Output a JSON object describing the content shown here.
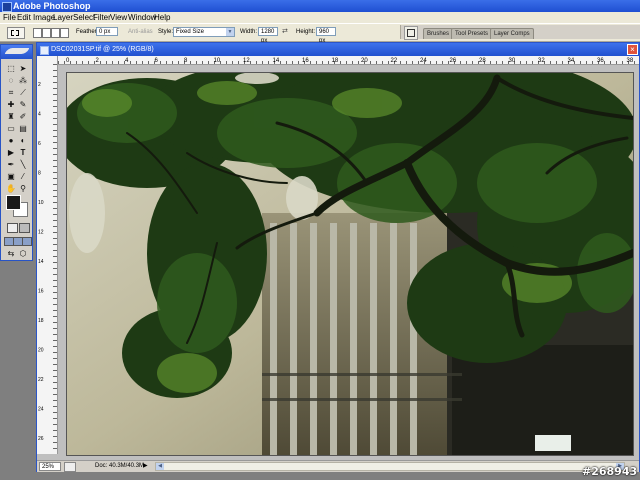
{
  "app": {
    "title": "Adobe Photoshop"
  },
  "menu": [
    "File",
    "Edit",
    "Image",
    "Layer",
    "Select",
    "Filter",
    "View",
    "Window",
    "Help"
  ],
  "options": {
    "feather_label": "Feather:",
    "feather_value": "0 px",
    "antialias_label": "Anti-alias",
    "style_label": "Style:",
    "style_value": "Fixed Size",
    "width_label": "Width:",
    "width_value": "1280 px",
    "height_label": "Height:",
    "height_value": "960 px"
  },
  "palette_well": {
    "tabs": [
      "Brushes",
      "Tool Presets",
      "Layer Comps"
    ]
  },
  "document": {
    "title": "DSC02031SP.tif @ 25% (RGB/8)",
    "ruler_marks": [
      "0",
      "2",
      "4",
      "6",
      "8",
      "10",
      "12",
      "14",
      "16",
      "18",
      "20",
      "22",
      "24",
      "26",
      "28",
      "30",
      "32",
      "34",
      "36",
      "38"
    ],
    "ruler_marks_v": [
      "2",
      "4",
      "6",
      "8",
      "10",
      "12",
      "14",
      "16",
      "18",
      "20",
      "22",
      "24",
      "26"
    ]
  },
  "status": {
    "zoom": "25%",
    "doc_info": "Doc: 40.3M/40.3M"
  },
  "watermark": "#268943",
  "colors": {
    "titlebar": "#2150cf",
    "chrome": "#ece9d8",
    "foreground": "#1a1a1a",
    "background": "#ffffff"
  }
}
